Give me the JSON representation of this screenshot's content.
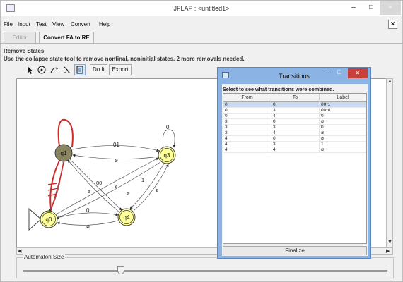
{
  "window": {
    "title": "JFLAP : <untitled1>",
    "minimize": "–",
    "maximize": "□",
    "close": "×"
  },
  "menu": {
    "items": [
      "File",
      "Input",
      "Test",
      "View",
      "Convert",
      "Help"
    ],
    "close": "×"
  },
  "tabs": [
    "Editor",
    "Convert FA to RE"
  ],
  "panel": {
    "title": "Remove States",
    "description": "Use the collapse state tool to remove nonfinal, noninitial states. 2 more removals needed."
  },
  "toolbar": {
    "tools": [
      "arrow-tool-icon",
      "state-tool-icon",
      "transition-tool-icon",
      "deleter-tool-icon",
      "collapse-state-tool-icon"
    ],
    "do_it": "Do It",
    "export": "Export"
  },
  "automaton": {
    "states": [
      {
        "id": "q1",
        "label": "q1",
        "kind": "collapsed"
      },
      {
        "id": "q3",
        "label": "q3",
        "kind": "final"
      },
      {
        "id": "q0",
        "label": "q0",
        "kind": "initial"
      },
      {
        "id": "q4",
        "label": "q4",
        "kind": "final"
      }
    ],
    "edge_labels": {
      "q1_q3": "01",
      "q3_q1": "ø",
      "q0_q4": "0",
      "q4_q0": "ø",
      "q3_loop": "0",
      "diag_a": "ø",
      "diag_b": "00",
      "diag_c": "ø",
      "diag_d": "ø",
      "diag_e": "1",
      "diag_f": "ø"
    }
  },
  "slider": {
    "label": "Automaton Size",
    "level_percent": 27
  },
  "dialog": {
    "title": "Transitions",
    "minimize": "–",
    "maximize": "□",
    "close": "×",
    "hint": "Select to see what transitions were combined.",
    "columns": [
      "From",
      "To",
      "Label"
    ],
    "rows": [
      {
        "from": "0",
        "to": "0",
        "label": "00*1",
        "selected": true
      },
      {
        "from": "0",
        "to": "3",
        "label": "00*01",
        "selected": false
      },
      {
        "from": "0",
        "to": "4",
        "label": "0",
        "selected": false
      },
      {
        "from": "3",
        "to": "0",
        "label": "ø",
        "selected": false
      },
      {
        "from": "3",
        "to": "3",
        "label": "0",
        "selected": false
      },
      {
        "from": "3",
        "to": "4",
        "label": "ø",
        "selected": false
      },
      {
        "from": "4",
        "to": "0",
        "label": "ø",
        "selected": false
      },
      {
        "from": "4",
        "to": "3",
        "label": "1",
        "selected": false
      },
      {
        "from": "4",
        "to": "4",
        "label": "ø",
        "selected": false
      }
    ],
    "finalize": "Finalize"
  },
  "colors": {
    "collapsed_state": "#8a8560",
    "state_fill": "#ffff99",
    "highlight_edge": "#d02a2a",
    "dialog_frame": "#8bb4e4",
    "dialog_close": "#c9403a",
    "selected_row": "#c9dbf2"
  }
}
